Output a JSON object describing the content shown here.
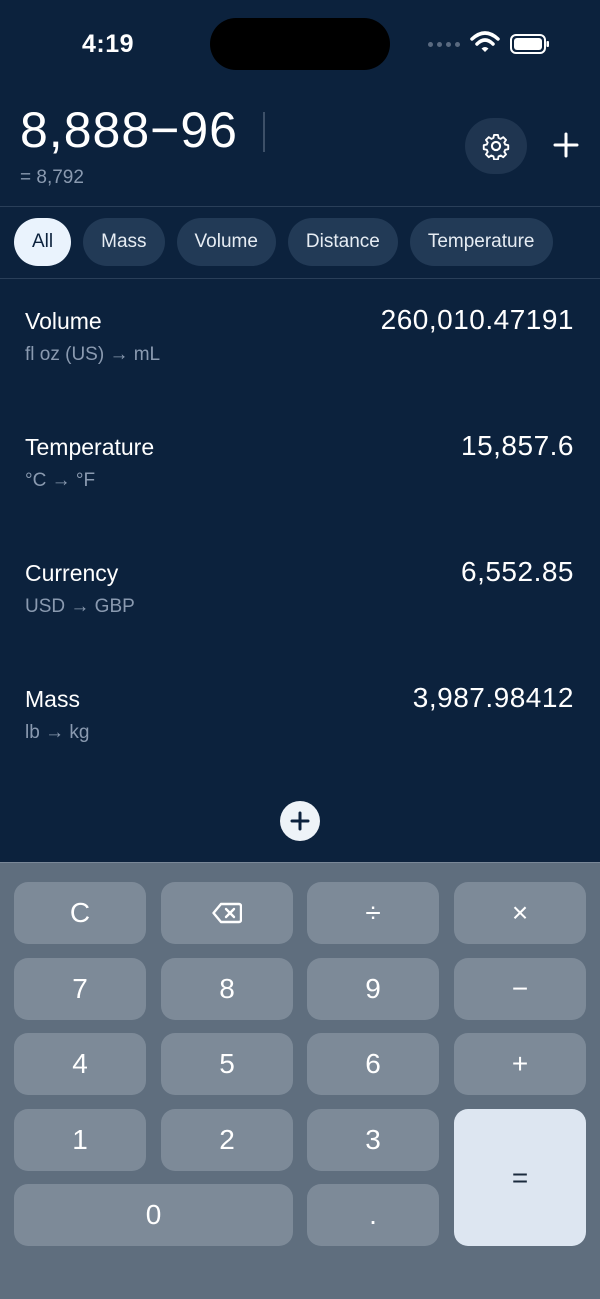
{
  "status": {
    "time": "4:19"
  },
  "header": {
    "expression": "8,888−96",
    "result": "= 8,792"
  },
  "tabs": [
    {
      "label": "All",
      "active": true
    },
    {
      "label": "Mass"
    },
    {
      "label": "Volume"
    },
    {
      "label": "Distance"
    },
    {
      "label": "Temperature"
    }
  ],
  "conversions": [
    {
      "category": "Volume",
      "units": "fl oz (US) → mL",
      "value": "260,010.47191"
    },
    {
      "category": "Temperature",
      "units": "°C → °F",
      "value": "15,857.6"
    },
    {
      "category": "Currency",
      "units": "USD → GBP",
      "value": "6,552.85"
    },
    {
      "category": "Mass",
      "units": "lb → kg",
      "value": "3,987.98412"
    }
  ],
  "keypad": {
    "clear": "C",
    "divide": "÷",
    "multiply": "×",
    "seven": "7",
    "eight": "8",
    "nine": "9",
    "minus": "−",
    "four": "4",
    "five": "5",
    "six": "6",
    "plus": "+",
    "one": "1",
    "two": "2",
    "three": "3",
    "equals": "=",
    "zero": "0",
    "decimal": "."
  },
  "icons": {
    "settings": "gear-icon",
    "add": "plus-icon",
    "backspace": "backspace-icon",
    "add_conversion": "plus-circle-icon"
  }
}
